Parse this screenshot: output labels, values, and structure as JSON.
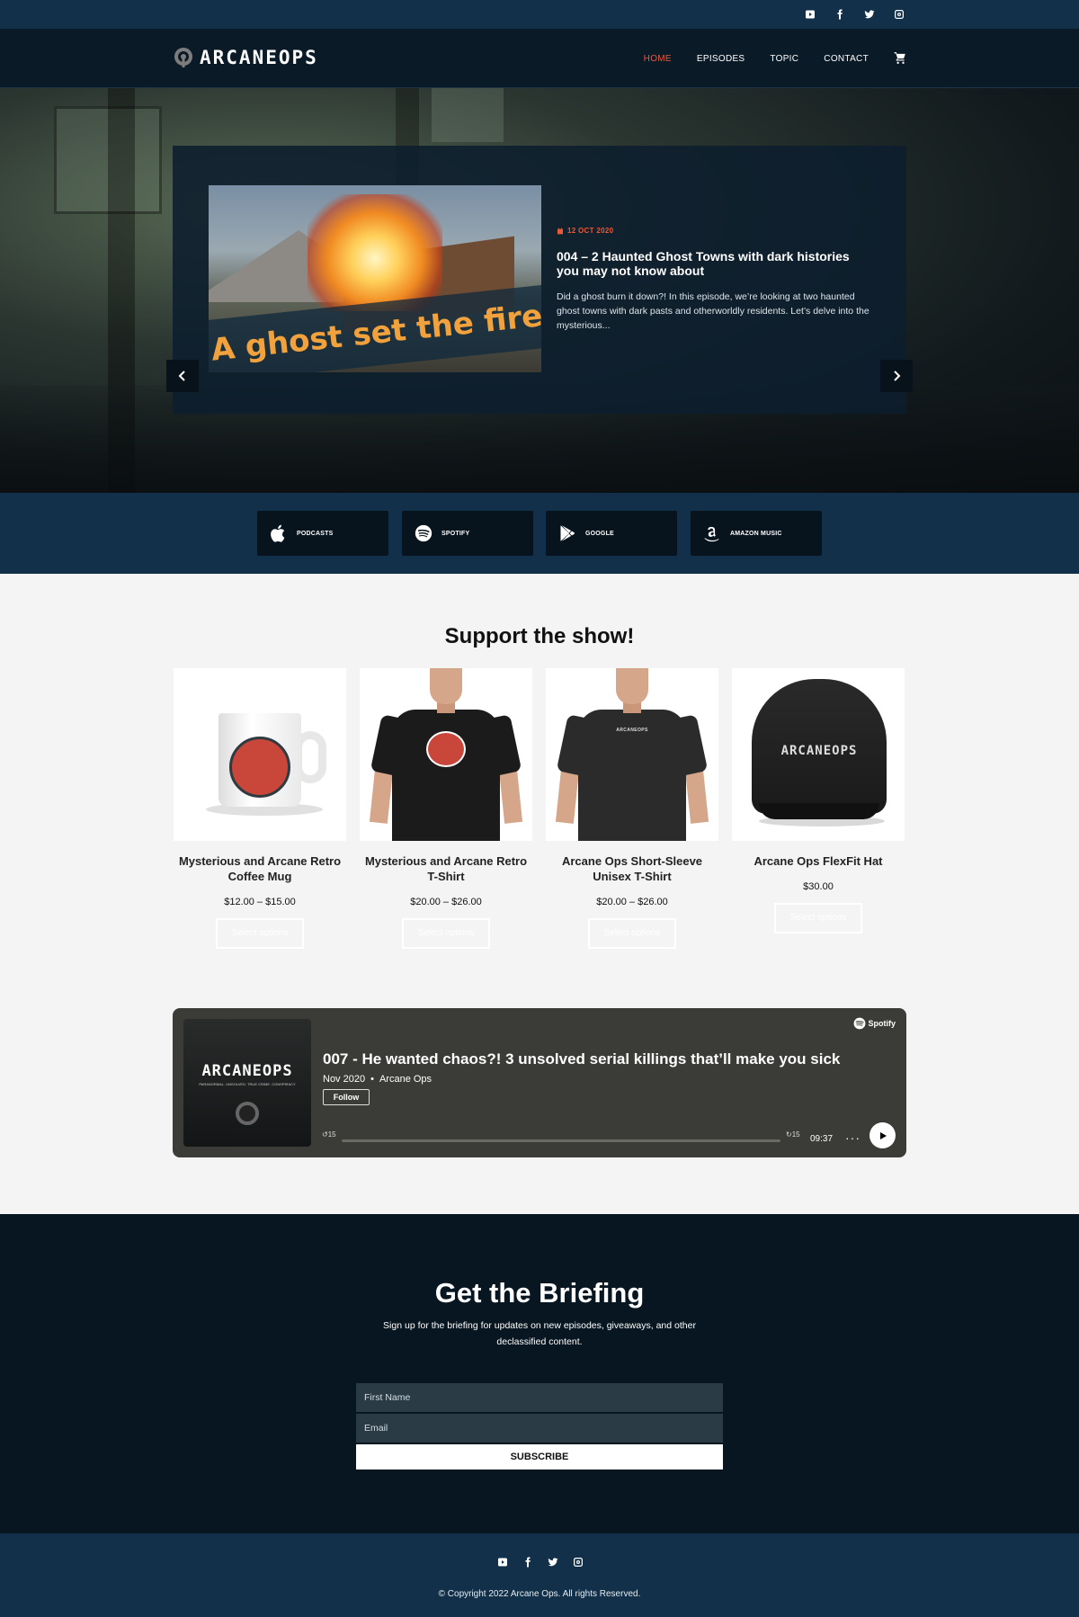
{
  "topbar": {
    "social_icons": [
      "youtube-icon",
      "facebook-icon",
      "twitter-icon",
      "instagram-icon"
    ]
  },
  "header": {
    "logo_text": "ARCANEOPS",
    "nav": [
      {
        "label": "HOME",
        "active": true
      },
      {
        "label": "EPISODES",
        "active": false
      },
      {
        "label": "TOPIC",
        "active": false
      },
      {
        "label": "CONTACT",
        "active": false
      }
    ],
    "cart_icon": "cart-icon"
  },
  "hero": {
    "slide": {
      "image_caption": "A ghost set the fire?!",
      "date": "12 OCT 2020",
      "title": "004 – 2 Haunted Ghost Towns with dark histories you may not know about",
      "excerpt": "Did a ghost burn it down?! In this episode, we’re looking at two haunted ghost towns with dark pasts and otherworldly residents. Let’s delve into the mysterious..."
    },
    "dots_count": 6,
    "active_dot": 3
  },
  "platforms": [
    {
      "label": "PODCASTS",
      "icon": "apple-icon"
    },
    {
      "label": "SPOTIFY",
      "icon": "spotify-icon"
    },
    {
      "label": "GOOGLE",
      "icon": "google-play-icon"
    },
    {
      "label": "AMAZON MUSIC",
      "icon": "amazon-icon"
    }
  ],
  "shop": {
    "title": "Support the show!",
    "products": [
      {
        "name": "Mysterious and Arcane Retro Coffee Mug",
        "price": "$12.00 – $15.00",
        "button": "Select options"
      },
      {
        "name": "Mysterious and Arcane Retro T-Shirt",
        "price": "$20.00 – $26.00",
        "button": "Select options"
      },
      {
        "name": "Arcane Ops Short-Sleeve Unisex T-Shirt",
        "price": "$20.00 – $26.00",
        "button": "Select options"
      },
      {
        "name": "Arcane Ops FlexFit Hat",
        "price": "$30.00",
        "button": "Select options"
      }
    ],
    "shirt_logo_text": "ARCANEOPS",
    "hat_logo_text": "ARCANEOPS"
  },
  "player": {
    "brand": "Spotify",
    "art_title": "ARCANEOPS",
    "art_subtitle": "PARANORMAL. UNSOLVED. TRUE CRIME. CONSPIRACY",
    "title": "007 - He wanted chaos?! 3 unsolved serial killings that’ll make you sick",
    "date": "Nov 2020",
    "separator": "•",
    "show": "Arcane Ops",
    "follow": "Follow",
    "skip_back": "15",
    "skip_fwd": "15",
    "time": "09:37",
    "more": "···",
    "progress": 0
  },
  "briefing": {
    "title": "Get the Briefing",
    "text": "Sign up for the briefing for updates on new episodes, giveaways, and other declassified content.",
    "first_name_placeholder": "First Name",
    "email_placeholder": "Email",
    "button": "SUBSCRIBE"
  },
  "footer": {
    "social_icons": [
      "youtube-icon",
      "facebook-icon",
      "twitter-icon",
      "instagram-icon"
    ],
    "copyright": "© Copyright 2022 Arcane Ops. All rights Reserved."
  },
  "colors": {
    "accent": "#e8593a",
    "navy": "#123049",
    "dark": "#071620",
    "player_bg": "#3b3c37"
  }
}
